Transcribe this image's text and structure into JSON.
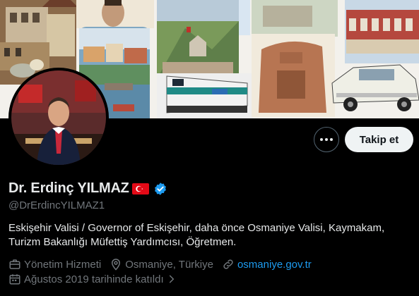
{
  "profile": {
    "display_name": "Dr. Erdinç YILMAZ",
    "handle": "@DrErdincYILMAZ1",
    "bio": "Eskişehir Valisi / Governor of Eskişehir, daha önce Osmaniye Valisi, Kaymakam, Turizm Bakanlığı Müfettiş Yardımcısı, Öğretmen.",
    "category": "Yönetim Hizmeti",
    "location": "Osmaniye, Türkiye",
    "website": "osmaniye.gov.tr",
    "joined": "Ağustos 2019 tarihinde katıldı",
    "verified": true,
    "flag_emoji": "turkey-flag"
  },
  "actions": {
    "follow_label": "Takip et",
    "more_icon": "more-horizontal-icon"
  },
  "icons": {
    "category": "briefcase-icon",
    "location": "location-pin-icon",
    "website": "link-icon",
    "joined": "calendar-icon",
    "joined_arrow": "chevron-right-icon"
  },
  "colors": {
    "background": "#000000",
    "text_primary": "#e7e9ea",
    "text_secondary": "#71767b",
    "accent": "#1d9bf0",
    "follow_bg": "#eff3f4",
    "follow_text": "#0f1419"
  }
}
